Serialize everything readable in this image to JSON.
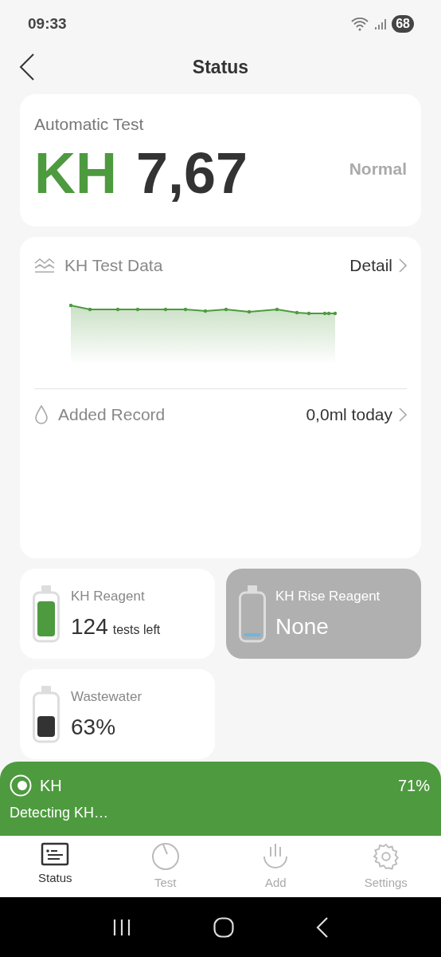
{
  "status_bar": {
    "time": "09:33",
    "battery": "68"
  },
  "header": {
    "title": "Status"
  },
  "result": {
    "label": "Automatic Test",
    "parameter": "KH",
    "value": "7,67",
    "status": "Normal"
  },
  "test_data": {
    "title": "KH Test Data",
    "link": "Detail"
  },
  "added_record": {
    "title": "Added Record",
    "value": "0,0ml today"
  },
  "reagents": [
    {
      "name": "KH Reagent",
      "value": "124",
      "unit": "tests left",
      "color": "#4e9a3f",
      "disabled": false
    },
    {
      "name": "KH Rise Reagent",
      "value": "None",
      "color": "#6fb6dd",
      "disabled": true
    },
    {
      "name": "Wastewater",
      "value": "63%",
      "color": "#333333",
      "disabled": false
    }
  ],
  "progress": {
    "name": "KH",
    "percent": "71%",
    "message": "Detecting KH…"
  },
  "tabs": [
    {
      "label": "Status",
      "selected": true
    },
    {
      "label": "Test",
      "selected": false
    },
    {
      "label": "Add",
      "selected": false
    },
    {
      "label": "Settings",
      "selected": false
    }
  ]
}
